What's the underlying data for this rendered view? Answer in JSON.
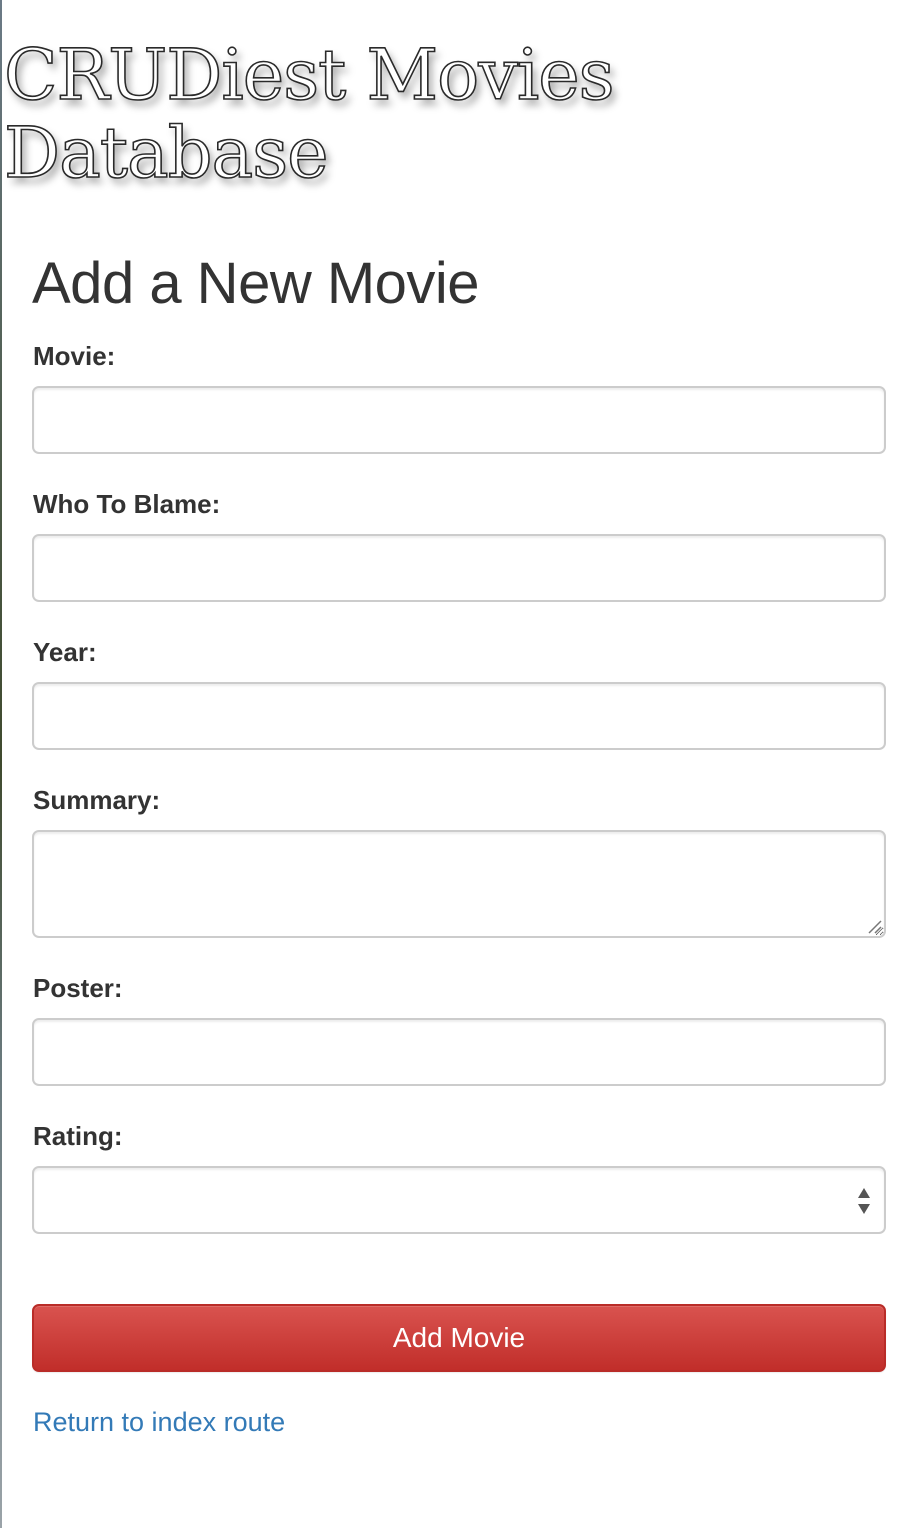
{
  "site": {
    "title_line1": "CRUDiest Movies",
    "title_line2": "Database"
  },
  "form": {
    "heading": "Add a New Movie",
    "fields": {
      "movie": {
        "label": "Movie:",
        "value": ""
      },
      "who_to_blame": {
        "label": "Who To Blame:",
        "value": ""
      },
      "year": {
        "label": "Year:",
        "value": ""
      },
      "summary": {
        "label": "Summary:",
        "value": ""
      },
      "poster": {
        "label": "Poster:",
        "value": ""
      },
      "rating": {
        "label": "Rating:",
        "selected": ""
      }
    },
    "submit_label": "Add Movie"
  },
  "links": {
    "return_label": "Return to index route"
  },
  "colors": {
    "button_red": "#d9534f",
    "link_blue": "#337ab7",
    "text_dark": "#333333",
    "input_border": "#cccccc"
  },
  "icons": {
    "select_arrows": "select-updown-arrows-icon",
    "textarea_resize": "resize-grip-icon"
  }
}
